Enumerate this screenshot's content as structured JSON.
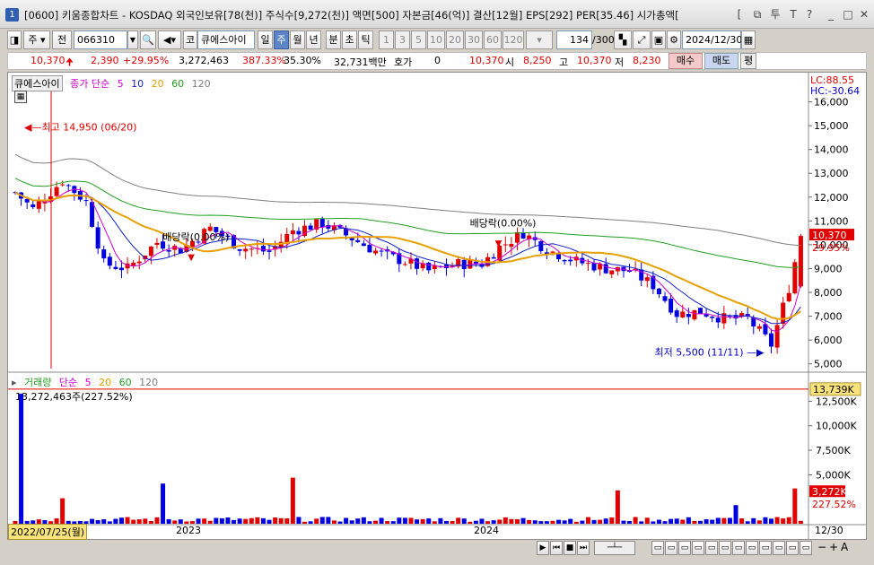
{
  "window": {
    "app_no": "1",
    "title": "[0600] 키움종합차트 - KOSDAQ 외국인보유[78(천)] 주식수[9,272(천)] 액면[500] 자본금[46(억)] 결산[12월] EPS[292] PER[35.46] 시가총액[",
    "controls": [
      "[",
      "□",
      "투",
      "T",
      "?",
      "_",
      "□",
      "✕"
    ]
  },
  "toolbar": {
    "period_select": "주",
    "all_label": "전",
    "code": "066310",
    "code_btn": "코",
    "stock_name": "큐에스아이",
    "periods": [
      "일",
      "주",
      "월",
      "년",
      "분",
      "초",
      "틱"
    ],
    "active_period": "주",
    "intervals": [
      "1",
      "3",
      "5",
      "10",
      "20",
      "30",
      "60",
      "120"
    ],
    "count": "134",
    "count_total": "/300",
    "date": "2024/12/30"
  },
  "quote": {
    "price": "10,370",
    "change": "2,390",
    "change_pct": "+29.95%",
    "volume": "3,272,463",
    "vol_pct": "387.33%",
    "turnover": "35.30%",
    "amount": "32,731백만",
    "hoga_label": "호가",
    "hoga_val": "0",
    "cur": "10,370",
    "open_label": "시",
    "open": "8,250",
    "high_label": "고",
    "high": "10,370",
    "low_label": "저",
    "low": "8,230",
    "buy_label": "매수",
    "sell_label": "매도",
    "eval_label": "평"
  },
  "price_legend": {
    "name": "큐에스아이",
    "ma_label": "종가 단순",
    "ma": [
      {
        "p": "5",
        "color": "#d000d0"
      },
      {
        "p": "10",
        "color": "#1020c8"
      },
      {
        "p": "20",
        "color": "#e8a000"
      },
      {
        "p": "60",
        "color": "#20a020"
      },
      {
        "p": "120",
        "color": "#808080"
      }
    ]
  },
  "vol_legend": {
    "name": "거래량",
    "ma_label": "단순",
    "ma": [
      {
        "p": "5",
        "color": "#d000d0"
      },
      {
        "p": "20",
        "color": "#e8a000"
      },
      {
        "p": "60",
        "color": "#20a020"
      },
      {
        "p": "120",
        "color": "#808080"
      }
    ]
  },
  "chart_data": [
    {
      "type": "candlestick",
      "title": "큐에스아이 주봉",
      "y_ticks": [
        "16,000",
        "15,000",
        "14,000",
        "13,000",
        "12,000",
        "11,000",
        "10,000",
        "9,000",
        "8,000",
        "7,000",
        "6,000",
        "5,000"
      ],
      "ylim": [
        4800,
        17000
      ],
      "lc": "LC:88.55",
      "hc": "HC:-30.64",
      "last_label": "10,370",
      "last_pct": "29.95%",
      "annotations": [
        {
          "text": "최고 14,950 (06/20)",
          "week": 0,
          "value": 14950
        },
        {
          "text": "최저 5,500 (11/11)",
          "week": 128,
          "value": 5500
        },
        {
          "text": "배당락(0.00%)",
          "week": 28,
          "value": 9800
        },
        {
          "text": "배당락(0.00%)",
          "week": 80,
          "value": 10400
        }
      ],
      "weeks": 134,
      "segments": [
        [
          0,
          12200
        ],
        [
          3,
          11500
        ],
        [
          8,
          12700
        ],
        [
          12,
          11800
        ],
        [
          15,
          9200
        ],
        [
          19,
          9000
        ],
        [
          24,
          10100
        ],
        [
          28,
          9800
        ],
        [
          33,
          10700
        ],
        [
          38,
          9900
        ],
        [
          43,
          9700
        ],
        [
          47,
          10600
        ],
        [
          52,
          10900
        ],
        [
          56,
          10400
        ],
        [
          62,
          9600
        ],
        [
          66,
          9300
        ],
        [
          70,
          8900
        ],
        [
          75,
          9200
        ],
        [
          79,
          9200
        ],
        [
          82,
          9900
        ],
        [
          86,
          10500
        ],
        [
          90,
          9800
        ],
        [
          95,
          9300
        ],
        [
          100,
          9000
        ],
        [
          104,
          8900
        ],
        [
          108,
          8300
        ],
        [
          112,
          7100
        ],
        [
          116,
          7200
        ],
        [
          120,
          6900
        ],
        [
          124,
          6900
        ],
        [
          128,
          5800
        ],
        [
          131,
          8200
        ],
        [
          133,
          10370
        ]
      ]
    },
    {
      "type": "bar",
      "title": "거래량",
      "y_ticks": [
        "12,500K",
        "10,000K",
        "7,500K",
        "5,000K"
      ],
      "ylim": [
        0,
        14000000
      ],
      "max_label": "13,739K",
      "max_text": "13,272,463주(227.52%)",
      "last_label": "3,272K",
      "last_pct": "227.52%",
      "spikes": [
        {
          "week": 1,
          "value": 13272463
        },
        {
          "week": 47,
          "value": 4700000
        },
        {
          "week": 25,
          "value": 4100000
        },
        {
          "week": 102,
          "value": 3400000
        },
        {
          "week": 132,
          "value": 3600000
        },
        {
          "week": 134,
          "value": 3272463
        },
        {
          "week": 8,
          "value": 2600000
        },
        {
          "week": 122,
          "value": 1900000
        }
      ]
    }
  ],
  "xaxis": {
    "start_label": "2022/07/25(월)",
    "labels": [
      {
        "text": "2023",
        "week": 27
      },
      {
        "text": "2024",
        "week": 79
      }
    ],
    "end_label": "12/30"
  }
}
